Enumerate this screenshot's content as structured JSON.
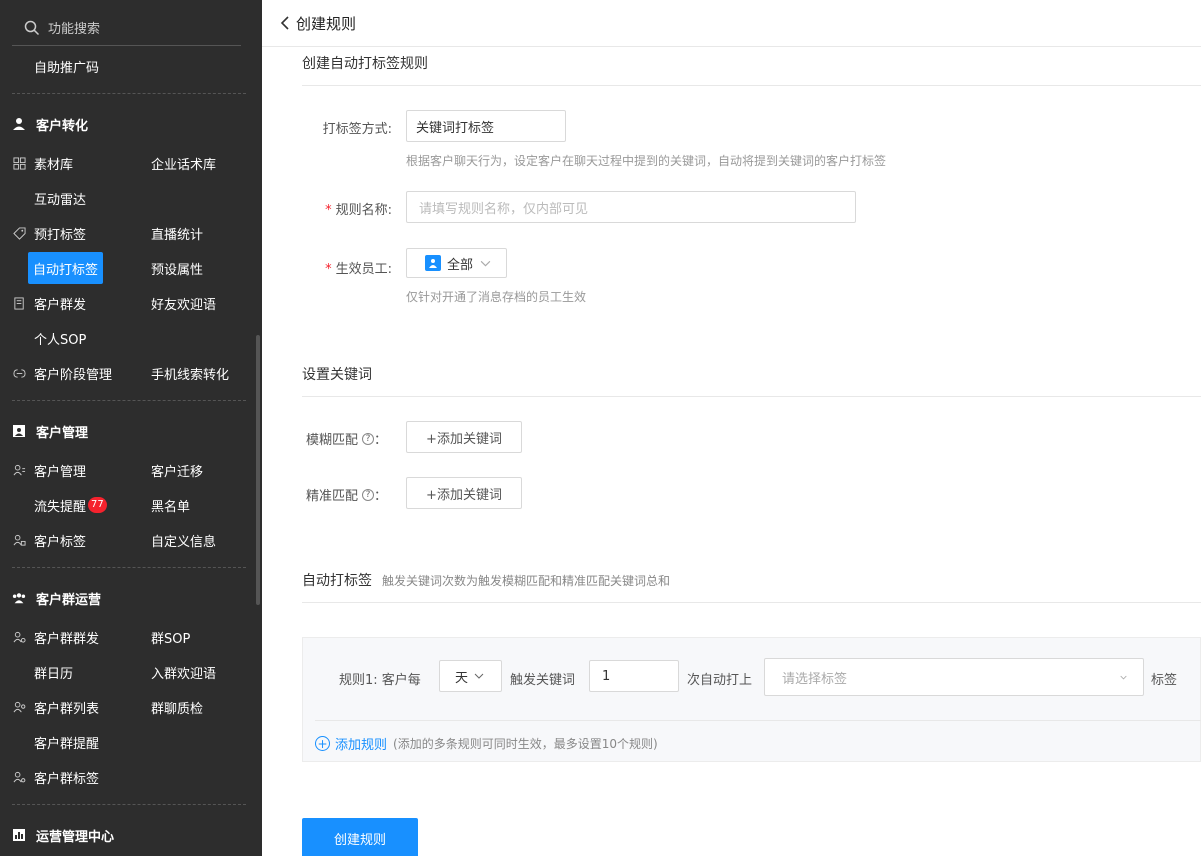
{
  "sidebar": {
    "search_placeholder": "功能搜索",
    "top_item": "自助推广码",
    "sections": {
      "conversion": "客户转化",
      "management": "客户管理",
      "group_ops": "客户群运营",
      "ops_center": "运营管理中心"
    },
    "items": {
      "material": "素材库",
      "scripts": "企业话术库",
      "radar": "互动雷达",
      "pre_tag": "预打标签",
      "live_stats": "直播统计",
      "auto_tag": "自动打标签",
      "preset_attr": "预设属性",
      "mass_send": "客户群发",
      "friend_welcome": "好友欢迎语",
      "personal_sop": "个人SOP",
      "stage_mgmt": "客户阶段管理",
      "phone_leads": "手机线索转化",
      "cust_mgmt": "客户管理",
      "cust_migrate": "客户迁移",
      "churn_alert": "流失提醒",
      "churn_badge": "77",
      "blacklist": "黑名单",
      "cust_tags": "客户标签",
      "custom_info": "自定义信息",
      "group_mass": "客户群群发",
      "group_sop": "群SOP",
      "group_calendar": "群日历",
      "group_welcome": "入群欢迎语",
      "group_list": "客户群列表",
      "group_qc": "群聊质检",
      "group_reminder": "客户群提醒",
      "group_tags": "客户群标签"
    }
  },
  "header": {
    "title": "创建规则"
  },
  "form": {
    "section1_title": "创建自动打标签规则",
    "method_label": "打标签方式:",
    "method_value": "关键词打标签",
    "method_hint": "根据客户聊天行为，设定客户在聊天过程中提到的关键词，自动将提到关键词的客户打标签",
    "name_label": "规则名称:",
    "name_placeholder": "请填写规则名称，仅内部可见",
    "staff_label": "生效员工:",
    "staff_value": "全部",
    "staff_hint": "仅针对开通了消息存档的员工生效",
    "required_mark": "*",
    "section2_title": "设置关键词",
    "fuzzy_label": "模糊匹配",
    "exact_label": "精准匹配",
    "colon": "：",
    "add_keyword": "+添加关键词",
    "section3_title": "自动打标签",
    "section3_hint": "触发关键词次数为触发模糊匹配和精准匹配关键词总和",
    "rule": {
      "prefix": "规则1:  客户每",
      "period": "天",
      "trigger": "触发关键词",
      "count": "1",
      "auto_tag": "次自动打上",
      "tag_placeholder": "请选择标签",
      "suffix": "标签"
    },
    "add_rule": "添加规则",
    "add_rule_hint": "(添加的多条规则可同时生效，最多设置10个规则)",
    "submit": "创建规则"
  },
  "colors": {
    "accent": "#1890ff",
    "sidebar_bg": "#2d2d2d",
    "badge": "#f5222d"
  }
}
